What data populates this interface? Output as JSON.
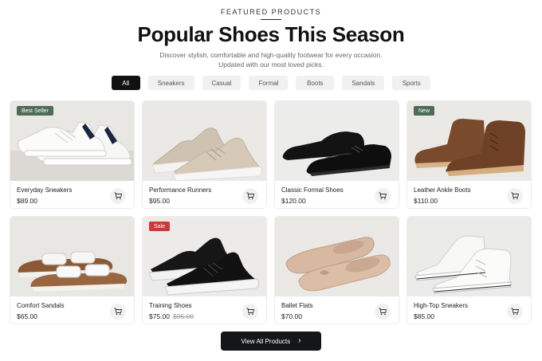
{
  "header": {
    "eyebrow": "FEATURED PRODUCTS",
    "title": "Popular Shoes This Season",
    "subtitle": "Discover stylish, comfortable and high-quality footwear for every occasion. Updated with our most loved picks."
  },
  "filters": [
    "All",
    "Sneakers",
    "Casual",
    "Formal",
    "Boots",
    "Sandals",
    "Sports"
  ],
  "active_filter": "All",
  "products": [
    {
      "name": "Everyday Sneakers",
      "price": "$89.00",
      "badge": "Best Seller",
      "badge_color": "#4d6b57",
      "image": "white-sneakers"
    },
    {
      "name": "Performance Runners",
      "price": "$95.00",
      "badge": "",
      "image": "beige-knit-runners"
    },
    {
      "name": "Classic Formal Shoes",
      "price": "$120.00",
      "badge": "",
      "image": "black-oxford-shoes"
    },
    {
      "name": "Leather Ankle Boots",
      "price": "$110.00",
      "badge": "New",
      "badge_color": "#4d6b57",
      "image": "brown-ankle-boots"
    },
    {
      "name": "Comfort Sandals",
      "price": "$65.00",
      "badge": "",
      "image": "two-strap-sandals"
    },
    {
      "name": "Training Shoes",
      "price": "$75.00",
      "old_price": "$95.00",
      "badge": "Sale",
      "badge_color": "#c93a3a",
      "image": "black-training-shoes"
    },
    {
      "name": "Ballet Flats",
      "price": "$70.00",
      "badge": "",
      "image": "nude-ballet-flats"
    },
    {
      "name": "High-Top Sneakers",
      "price": "$85.00",
      "badge": "",
      "image": "white-high-tops"
    }
  ],
  "cta": {
    "label": "View All Products",
    "icon": "chevron-right-icon"
  },
  "icons": {
    "cart": "cart-icon"
  },
  "colors": {
    "primary": "#15161a",
    "chip_bg": "#f1f1f1",
    "badge_green": "#4d6b57",
    "badge_red": "#c93a3a"
  }
}
